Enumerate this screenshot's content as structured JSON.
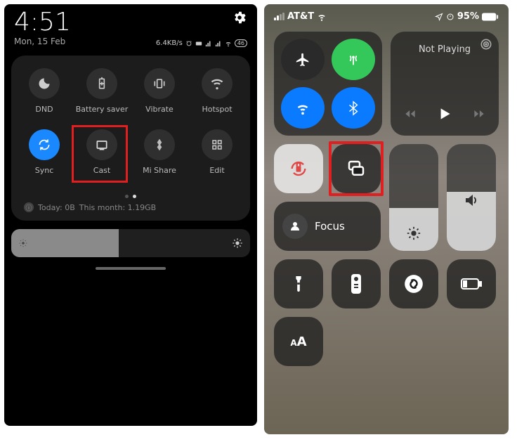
{
  "android": {
    "time": "4:51",
    "date": "Mon, 15 Feb",
    "network_speed": "6.4KB/s",
    "battery_label": "46",
    "tiles": [
      {
        "label": "DND",
        "active": false
      },
      {
        "label": "Battery saver",
        "active": false
      },
      {
        "label": "Vibrate",
        "active": false
      },
      {
        "label": "Hotspot",
        "active": false
      },
      {
        "label": "Sync",
        "active": true
      },
      {
        "label": "Cast",
        "active": false,
        "highlighted": true
      },
      {
        "label": "Mi Share",
        "active": false
      },
      {
        "label": "Edit",
        "active": false
      }
    ],
    "usage_today": "Today: 0B",
    "usage_month": "This month: 1.19GB",
    "brightness_pct": 45
  },
  "ios": {
    "carrier": "AT&T",
    "battery_pct": "95%",
    "media_title": "Not Playing",
    "focus_label": "Focus",
    "brightness_fill_pct": 40,
    "volume_fill_pct": 55,
    "text_size_label": "ᴀA"
  }
}
